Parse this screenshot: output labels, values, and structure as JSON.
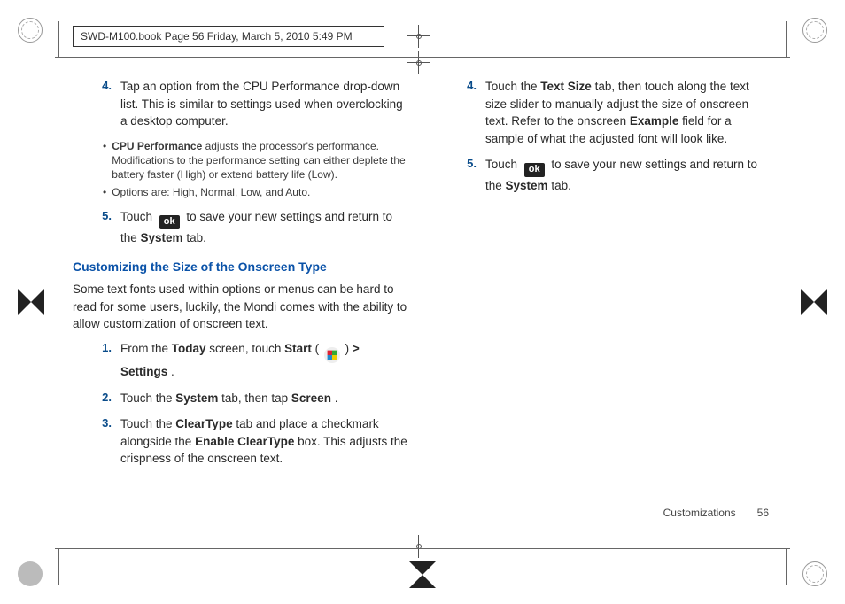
{
  "header": {
    "label": "SWD-M100.book  Page 56  Friday, March 5, 2010  5:49 PM"
  },
  "left": {
    "item4": {
      "num": "4.",
      "text_a": "Tap an option from the CPU Performance drop-down list. This is similar to settings used when overclocking a desktop computer.",
      "bullets": [
        {
          "lead": "CPU Performance",
          "rest": " adjusts the processor's performance. Modifications to the performance setting can either deplete the battery faster (High) or extend battery life (Low)."
        },
        {
          "rest": "Options are: High, Normal, Low, and Auto."
        }
      ]
    },
    "item5": {
      "num": "5.",
      "pre": "Touch ",
      "ok": "ok",
      "mid": " to save your new settings and return to the ",
      "bold": "System",
      "post": " tab."
    },
    "section_title": "Customizing the Size of the Onscreen Type",
    "section_intro": "Some text fonts used within options or menus can be hard to read for some users, luckily, the Mondi comes with the ability to allow customization of onscreen text.",
    "s1": {
      "num": "1.",
      "pre": "From the ",
      "b1": "Today",
      "mid1": " screen, touch ",
      "b2": "Start",
      "paren_open": " (",
      "paren_close": ") ",
      "gt": ">",
      "b3": " Settings",
      "post": "."
    },
    "s2": {
      "num": "2.",
      "pre": "Touch the ",
      "b1": "System",
      "mid": " tab, then tap ",
      "b2": "Screen",
      "post": "."
    },
    "s3": {
      "num": "3.",
      "pre": "Touch the ",
      "b1": "ClearType",
      "mid1": " tab and place a checkmark alongside the ",
      "b2": "Enable ClearType",
      "mid2": " box. This adjusts the crispness of the onscreen text."
    }
  },
  "right": {
    "item4": {
      "num": "4.",
      "pre": "Touch the ",
      "b1": "Text Size",
      "mid1": " tab, then touch along the text size slider to manually adjust the size of onscreen text. Refer to the onscreen ",
      "b2": "Example",
      "mid2": " field for a sample of what the adjusted font will look like."
    },
    "item5": {
      "num": "5.",
      "pre": "Touch ",
      "ok": "ok",
      "mid": " to save your new settings and return to the ",
      "bold": "System",
      "post": " tab."
    }
  },
  "footer": {
    "section": "Customizations",
    "page": "56"
  }
}
